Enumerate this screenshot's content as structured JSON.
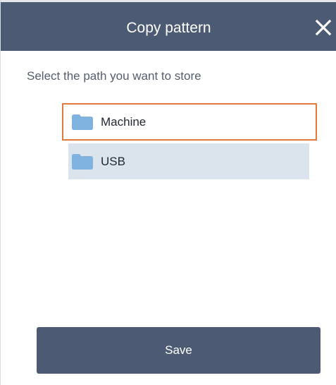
{
  "dialog": {
    "title": "Copy pattern",
    "close_icon": "close-icon",
    "instruction": "Select the path you want to store",
    "paths": [
      {
        "label": "Machine",
        "icon": "folder-icon",
        "state": "selected"
      },
      {
        "label": "USB",
        "icon": "folder-icon",
        "state": "unselected"
      }
    ],
    "save_label": "Save"
  },
  "colors": {
    "header": "#4c5a73",
    "selected_border": "#e07b3c",
    "option_background": "#dbe3ec",
    "folder": "#7fb2de"
  }
}
